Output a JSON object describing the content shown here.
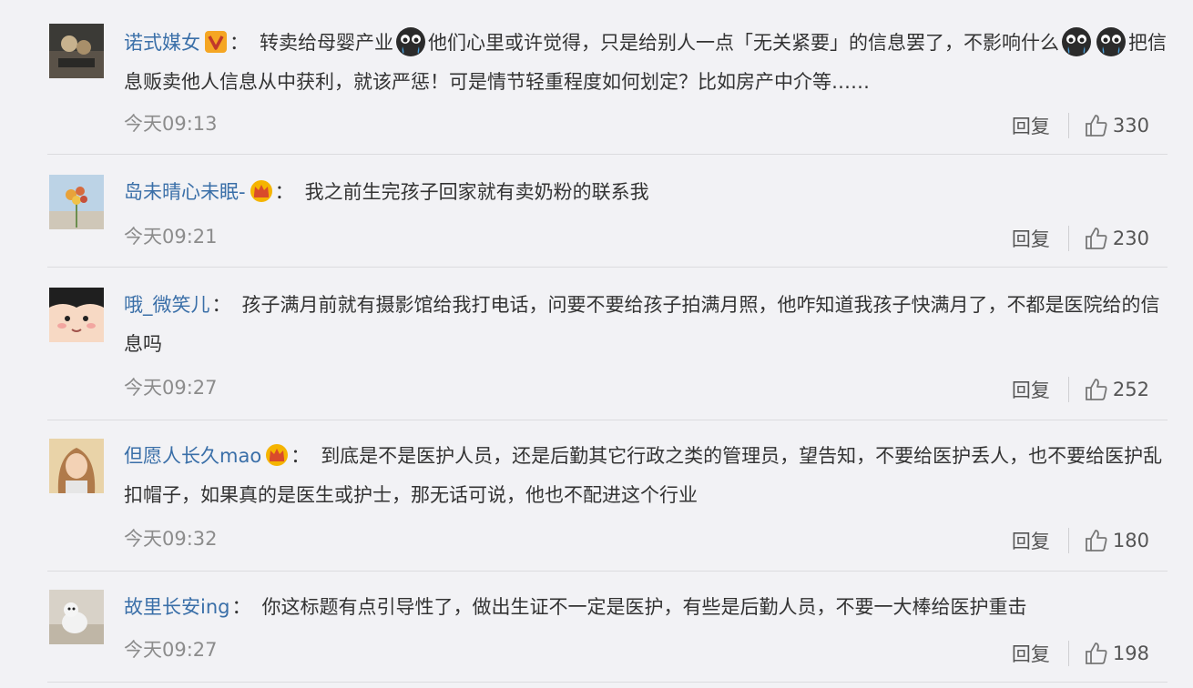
{
  "comments": [
    {
      "username": "诺式媒女",
      "badge": "v-badge",
      "text_parts": [
        "转卖给母婴产业",
        "他们心里或许觉得，只是给别人一点「无关紧要」的信息罢了，不影响什么",
        "把信息贩卖他人信息从中获利，就该严惩！可是情节轻重程度如何划定？比如房产中介等……"
      ],
      "time": "今天09:13",
      "reply": "回复",
      "likes": "330"
    },
    {
      "username": "岛未晴心未眠-",
      "badge": "crown-badge",
      "text": "我之前生完孩子回家就有卖奶粉的联系我",
      "time": "今天09:21",
      "reply": "回复",
      "likes": "230"
    },
    {
      "username": "哦_微笑儿",
      "text": "孩子满月前就有摄影馆给我打电话，问要不要给孩子拍满月照，他咋知道我孩子快满月了，不都是医院给的信息吗",
      "time": "今天09:27",
      "reply": "回复",
      "likes": "252"
    },
    {
      "username": "但愿人长久mao",
      "badge": "crown-badge",
      "text": "到底是不是医护人员，还是后勤其它行政之类的管理员，望告知，不要给医护丢人，也不要给医护乱扣帽子，如果真的是医生或护士，那无话可说，他也不配进这个行业",
      "time": "今天09:32",
      "reply": "回复",
      "likes": "180"
    },
    {
      "username": "故里长安ing",
      "text": "你这标题有点引导性了，做出生证不一定是医护，有些是后勤人员，不要一大棒给医护重击",
      "time": "今天09:27",
      "reply": "回复",
      "likes": "198"
    }
  ],
  "colors": {
    "username": "#3a6fa8",
    "text": "#333333",
    "time": "#8c8c8c",
    "background": "#f2f2f5",
    "v_badge": "#f5a623",
    "crown": "#f5b400"
  },
  "colon": "："
}
